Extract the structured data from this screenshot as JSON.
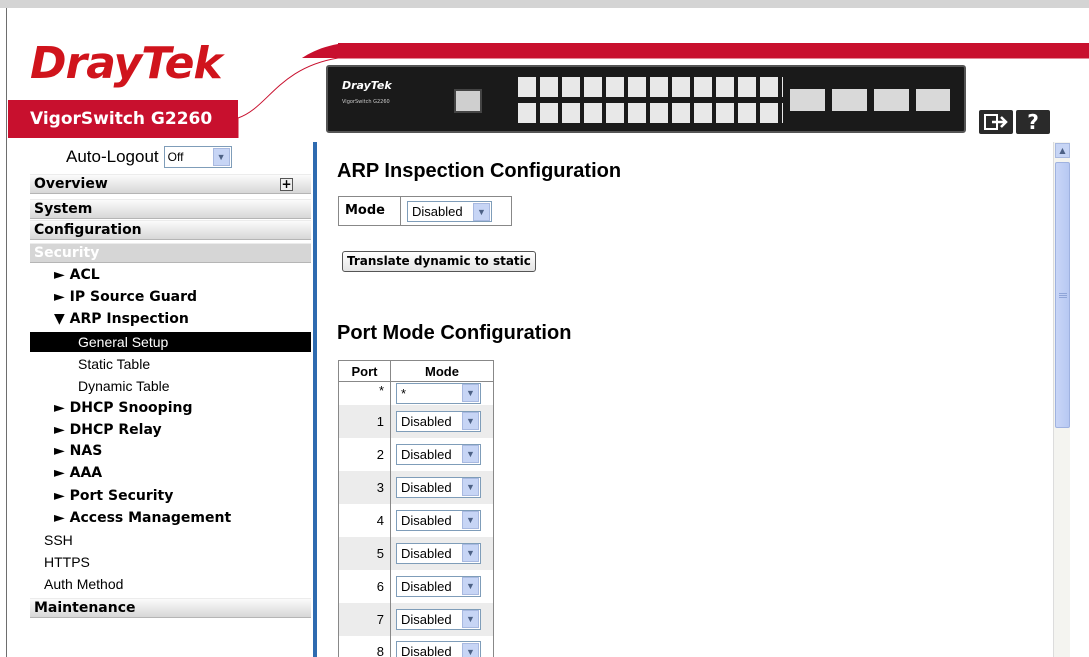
{
  "header": {
    "logo": "DrayTek",
    "product_name": "VigorSwitch G2260",
    "device_brand": "DrayTek",
    "device_model": "VigorSwitch G2260",
    "logout_icon": "logout-icon",
    "help_label": "?"
  },
  "sidebar": {
    "autologout_label": "Auto-Logout",
    "autologout_value": "Off",
    "sections": {
      "overview": "Overview",
      "system": "System",
      "configuration": "Configuration",
      "security": "Security",
      "maintenance": "Maintenance"
    },
    "security_items": {
      "acl": "► ACL",
      "ip_source_guard": "► IP Source Guard",
      "arp_inspection": "▼ ARP Inspection",
      "general_setup": "General Setup",
      "static_table": "Static Table",
      "dynamic_table": "Dynamic Table",
      "dhcp_snooping": "► DHCP Snooping",
      "dhcp_relay": "► DHCP Relay",
      "nas": "► NAS",
      "aaa": "► AAA",
      "port_security": "► Port Security",
      "access_management": "► Access Management",
      "ssh": "SSH",
      "https": "HTTPS",
      "auth_method": "Auth Method"
    }
  },
  "main": {
    "arp_title": "ARP Inspection Configuration",
    "mode_label": "Mode",
    "mode_value": "Disabled",
    "translate_button": "Translate dynamic to static",
    "port_title": "Port Mode Configuration",
    "port_table": {
      "headers": [
        "Port",
        "Mode"
      ],
      "rows": [
        {
          "port": "*",
          "mode": "*"
        },
        {
          "port": "1",
          "mode": "Disabled"
        },
        {
          "port": "2",
          "mode": "Disabled"
        },
        {
          "port": "3",
          "mode": "Disabled"
        },
        {
          "port": "4",
          "mode": "Disabled"
        },
        {
          "port": "5",
          "mode": "Disabled"
        },
        {
          "port": "6",
          "mode": "Disabled"
        },
        {
          "port": "7",
          "mode": "Disabled"
        },
        {
          "port": "8",
          "mode": "Disabled"
        }
      ]
    }
  },
  "colors": {
    "brand_red": "#d0141c",
    "nav_active_bg": "#000000",
    "divider_blue": "#2e6bb0"
  }
}
